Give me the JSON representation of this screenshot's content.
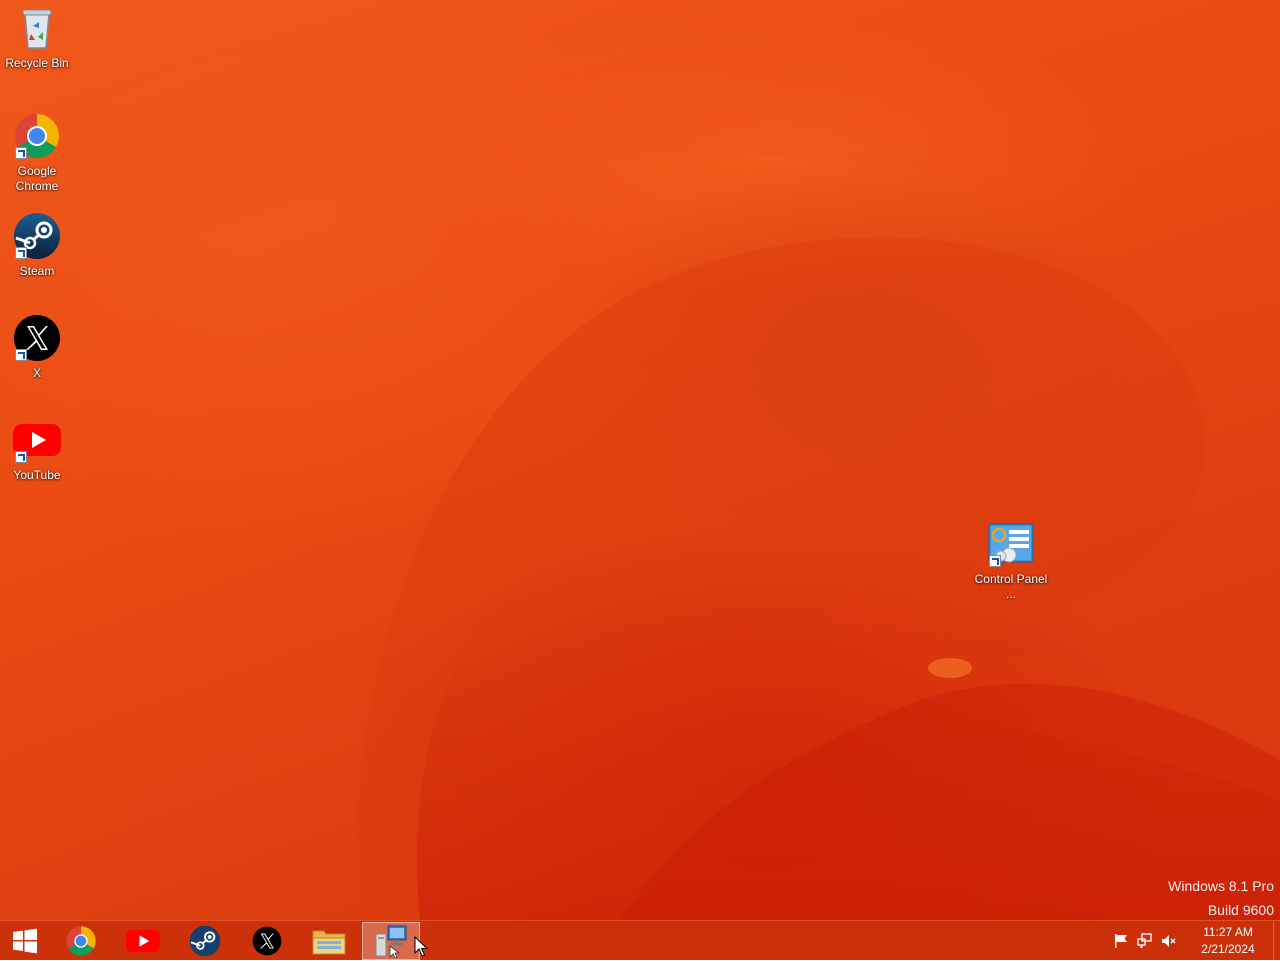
{
  "desktop": {
    "icons": [
      {
        "label": "Recycle Bin",
        "icon": "recycle-bin-icon"
      },
      {
        "label": "Google Chrome",
        "icon": "chrome-icon"
      },
      {
        "label": "Steam",
        "icon": "steam-icon"
      },
      {
        "label": "X",
        "icon": "x-icon"
      },
      {
        "label": "YouTube",
        "icon": "youtube-icon"
      },
      {
        "label": "Control Panel ...",
        "icon": "control-panel-icon"
      }
    ],
    "watermark": {
      "line1": "Windows 8.1 Pro",
      "line2": "Build 9600"
    }
  },
  "taskbar": {
    "buttons": [
      {
        "icon": "windows-start-icon"
      },
      {
        "icon": "chrome-icon"
      },
      {
        "icon": "youtube-icon"
      },
      {
        "icon": "steam-icon"
      },
      {
        "icon": "x-icon"
      },
      {
        "icon": "file-explorer-icon"
      },
      {
        "icon": "display-settings-icon",
        "active": true
      }
    ],
    "tray": {
      "icons": [
        "action-center-flag-icon",
        "network-icon",
        "volume-muted-icon"
      ],
      "time": "11:27 AM",
      "date": "2/21/2024"
    }
  },
  "colors": {
    "wallpaper_base": "#e94a12",
    "wallpaper_dark": "#cf1d08",
    "taskbar": "#c82e0a"
  }
}
